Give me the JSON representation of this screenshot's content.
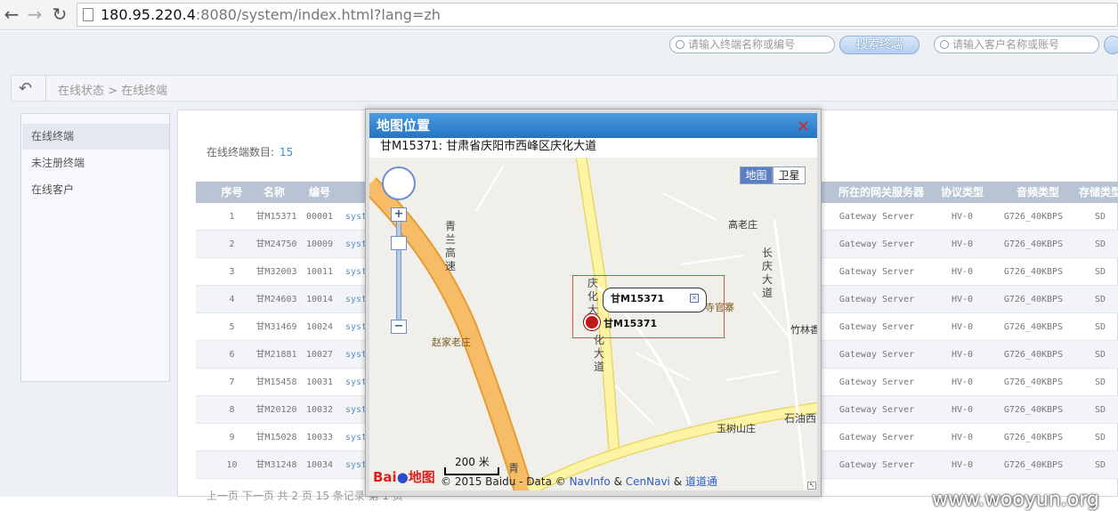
{
  "browser": {
    "url_host": "180.95.220.4",
    "url_rest": ":8080/system/index.html?lang=zh",
    "back_icon": "arrow-left-icon",
    "forward_icon": "arrow-right-icon",
    "reload_icon": "reload-icon"
  },
  "header": {
    "search_terminal_placeholder": "请输入终端名称或编号",
    "search_terminal_button": "搜索终端",
    "search_customer_placeholder": "请输入客户名称或账号"
  },
  "breadcrumb": {
    "text": "在线状态 > 在线终端",
    "back_icon": "share-back-icon"
  },
  "sidebar": {
    "items": [
      {
        "label": "在线终端",
        "active": true
      },
      {
        "label": "未注册终端",
        "active": false
      },
      {
        "label": "在线客户",
        "active": false
      }
    ]
  },
  "main": {
    "count_label": "在线终端数目:",
    "count_value": "15",
    "columns": [
      "序号",
      "名称",
      "编号",
      "所在的网关服务器",
      "协议类型",
      "音频类型",
      "存储类型"
    ],
    "rows": [
      {
        "idx": "1",
        "name": "甘M15371",
        "id": "00001",
        "sys": "syst",
        "gateway": "Gateway Server",
        "protocol": "HV-0",
        "audio": "G726_40KBPS",
        "storage": "SD"
      },
      {
        "idx": "2",
        "name": "甘M24750",
        "id": "10009",
        "sys": "syst",
        "gateway": "Gateway Server",
        "protocol": "HV-0",
        "audio": "G726_40KBPS",
        "storage": "SD"
      },
      {
        "idx": "3",
        "name": "甘M32003",
        "id": "10011",
        "sys": "syst",
        "gateway": "Gateway Server",
        "protocol": "HV-0",
        "audio": "G726_40KBPS",
        "storage": "SD"
      },
      {
        "idx": "4",
        "name": "甘M24603",
        "id": "10014",
        "sys": "syst",
        "gateway": "Gateway Server",
        "protocol": "HV-0",
        "audio": "G726_40KBPS",
        "storage": "SD"
      },
      {
        "idx": "5",
        "name": "甘M31469",
        "id": "10024",
        "sys": "syst",
        "gateway": "Gateway Server",
        "protocol": "HV-0",
        "audio": "G726_40KBPS",
        "storage": "SD"
      },
      {
        "idx": "6",
        "name": "甘M21881",
        "id": "10027",
        "sys": "syst",
        "gateway": "Gateway Server",
        "protocol": "HV-0",
        "audio": "G726_40KBPS",
        "storage": "SD"
      },
      {
        "idx": "7",
        "name": "甘M15458",
        "id": "10031",
        "sys": "syst",
        "gateway": "Gateway Server",
        "protocol": "HV-0",
        "audio": "G726_40KBPS",
        "storage": "SD"
      },
      {
        "idx": "8",
        "name": "甘M20120",
        "id": "10032",
        "sys": "syst",
        "gateway": "Gateway Server",
        "protocol": "HV-0",
        "audio": "G726_40KBPS",
        "storage": "SD"
      },
      {
        "idx": "9",
        "name": "甘M15028",
        "id": "10033",
        "sys": "syst",
        "gateway": "Gateway Server",
        "protocol": "HV-0",
        "audio": "G726_40KBPS",
        "storage": "SD"
      },
      {
        "idx": "10",
        "name": "甘M31248",
        "id": "10034",
        "sys": "syst",
        "gateway": "Gateway Server",
        "protocol": "HV-0",
        "audio": "G726_40KBPS",
        "storage": "SD"
      }
    ],
    "pager_text": "上一页 下一页 共 2 页 15 条记录 第 1 页"
  },
  "dialog": {
    "title": "地图位置",
    "close_icon": "close-x-icon",
    "address": "甘M15371:  甘肃省庆阳市西峰区庆化大道",
    "map_type_map": "地图",
    "map_type_satellite": "卫星",
    "zoom_in": "+",
    "zoom_out": "−",
    "labels": {
      "gaolaozhuang": "高老庄",
      "zhaojialaozhuang": "赵家老庄",
      "siguanzhai": "寺官寨",
      "zhulin": "竹林香",
      "yushushan": "玉树山庄",
      "changqing": "长庆大道",
      "qinglan": "青兰高速",
      "qinghua_upper": "庆化大",
      "qinghua_lower": "化大道",
      "shiyou": "石油西",
      "qing_bottom": "青"
    },
    "bubble_text": "甘M15371",
    "marker_label": "甘M15371",
    "scale": "200 米",
    "baidu_logo": "Bai",
    "baidu_logo_tail": "地图",
    "copyright_prefix": "© 2015 Baidu - Data ©",
    "copyright_navinfo": "NavInfo",
    "copyright_amp1": "&",
    "copyright_cennavi": "CenNavi",
    "copyright_amp2": "&",
    "copyright_daodaotong": "道道通"
  },
  "watermark": "www.wooyun.org",
  "colors": {
    "accent": "#2374c4",
    "table_header": "#b8c4d4",
    "road_major": "#f3b95f",
    "road_yellow": "#fdf2a0"
  }
}
